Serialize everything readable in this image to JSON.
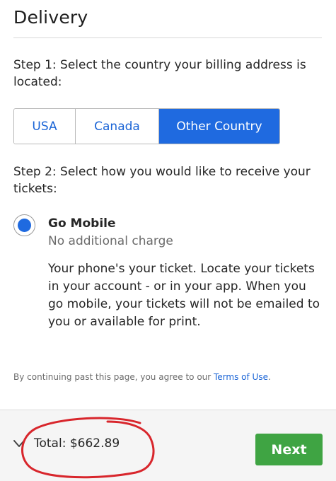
{
  "header": {
    "title": "Delivery"
  },
  "step1": {
    "text": "Step 1: Select the country your billing address is located:",
    "options": [
      "USA",
      "Canada",
      "Other Country"
    ],
    "selected": "Other Country"
  },
  "step2": {
    "text": "Step 2: Select how you would like to receive your tickets:",
    "option": {
      "title": "Go Mobile",
      "subtitle": "No additional charge",
      "description": "Your phone's your ticket. Locate your tickets in your account - or in your app. When you go mobile, your tickets will not be emailed to you or available for print.",
      "selected": true
    }
  },
  "terms": {
    "prefix": "By continuing past this page, you agree to our ",
    "link": "Terms of Use",
    "suffix": "."
  },
  "footer": {
    "total_label": "Total: $662.89",
    "next_label": "Next",
    "chevron_icon": "chevron-down-icon"
  },
  "colors": {
    "accent_blue": "#1f6ae0",
    "link_blue": "#1a64d6",
    "next_green": "#3fa443",
    "annotation_red": "#d8262c"
  }
}
